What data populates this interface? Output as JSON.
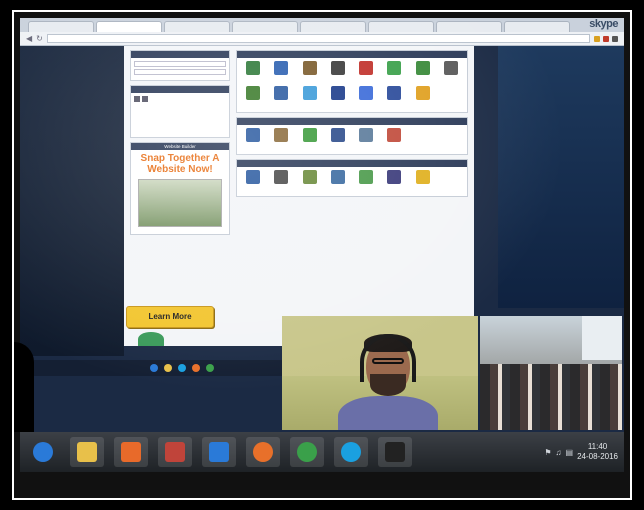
{
  "browser": {
    "tabs": [
      "",
      "",
      "",
      "",
      "",
      "",
      "",
      ""
    ],
    "active_tab": 1,
    "brand": "skype",
    "url": ""
  },
  "page": {
    "left": {
      "search_head": "",
      "announce_head": "",
      "builder_head": "Website Builder",
      "builder_title": "Snap Together A Website Now!",
      "builder_text": "",
      "learn_more": "Learn More"
    },
    "sections": [
      {
        "head": "",
        "icons": [
          {
            "color": "#2f7a3a"
          },
          {
            "color": "#2a5fb0"
          },
          {
            "color": "#7a5a2a"
          },
          {
            "color": "#3a3a3a"
          },
          {
            "color": "#c0302a"
          },
          {
            "color": "#3aa04a"
          },
          {
            "color": "#3a8a3a"
          },
          {
            "color": "#5a5a5a"
          },
          {
            "color": "#3a7a2a"
          },
          {
            "color": "#2a5aa0"
          },
          {
            "color": "#3a9ad8"
          },
          {
            "color": "#1a3a8a"
          },
          {
            "color": "#3a6ad8"
          },
          {
            "color": "#2a4a9a"
          },
          {
            "color": "#e0a020"
          }
        ]
      },
      {
        "head": "",
        "icons": [
          {
            "color": "#2a5aa0"
          },
          {
            "color": "#8a6a3a"
          },
          {
            "color": "#3a9a3a"
          },
          {
            "color": "#2a4a8a"
          },
          {
            "color": "#5a7a9a"
          },
          {
            "color": "#c04a3a"
          }
        ]
      },
      {
        "head": "",
        "icons": [
          {
            "color": "#2a5aa0"
          },
          {
            "color": "#4a4a4a"
          },
          {
            "color": "#6a8a3a"
          },
          {
            "color": "#3a6aa0"
          },
          {
            "color": "#4a9a4a"
          },
          {
            "color": "#3a3a7a"
          },
          {
            "color": "#e0b020"
          }
        ]
      }
    ]
  },
  "taskbar": {
    "items": [
      {
        "name": "ie-icon",
        "color": "#2a7ad8"
      },
      {
        "name": "folder-icon",
        "color": "#e8c04a"
      },
      {
        "name": "media-player-icon",
        "color": "#e86a2a"
      },
      {
        "name": "outlook-icon",
        "color": "#c0443a"
      },
      {
        "name": "hp-icon",
        "color": "#2a7ad8"
      },
      {
        "name": "firefox-icon",
        "color": "#e8702a"
      },
      {
        "name": "chrome-icon",
        "color": "#3aa04a"
      },
      {
        "name": "skype-icon",
        "color": "#1aa0e0"
      },
      {
        "name": "cmd-icon",
        "color": "#222"
      }
    ],
    "time": "11:40",
    "date": "24-08-2016"
  }
}
